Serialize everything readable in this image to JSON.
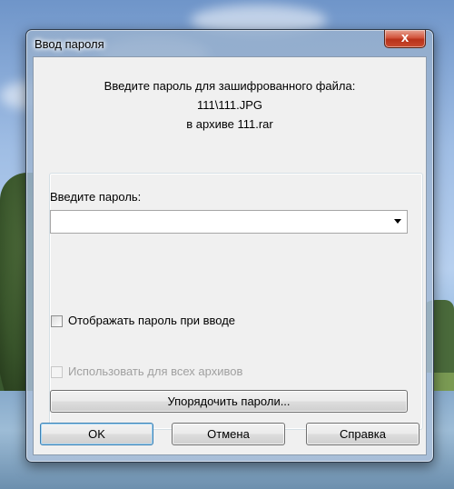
{
  "dialog": {
    "title": "Ввод пароля",
    "close_glyph": "x",
    "prompt_line1": "Введите пароль для зашифрованного файла:",
    "file_name": "111\\111.JPG",
    "archive_line": "в архиве 111.rar"
  },
  "password": {
    "label": "Введите пароль:",
    "value": ""
  },
  "options": {
    "show_password_label": "Отображать пароль при вводе",
    "show_password_checked": false,
    "use_for_all_label": "Использовать для всех архивов",
    "use_for_all_checked": false,
    "use_for_all_enabled": false
  },
  "buttons": {
    "organize_label": "Упорядочить пароли...",
    "ok_label": "OK",
    "cancel_label": "Отмена",
    "help_label": "Справка"
  }
}
